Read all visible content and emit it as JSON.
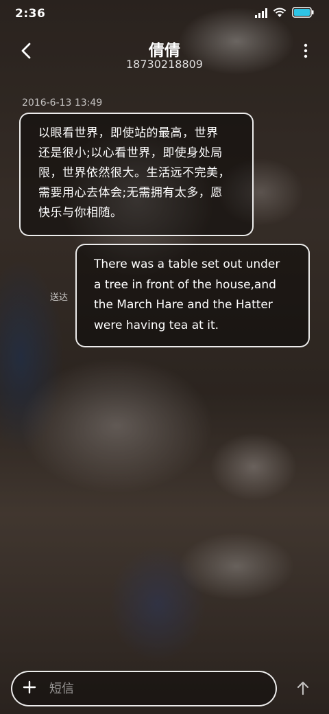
{
  "status_bar": {
    "time": "2:36",
    "icons": [
      "signal-icon",
      "wifi-icon",
      "battery-icon"
    ]
  },
  "header": {
    "contact_name": "倩倩",
    "contact_number": "18730218809",
    "back_icon": "back-arrow-icon",
    "more_icon": "more-vertical-icon"
  },
  "conversation": {
    "timestamp": "2016-6-13 13:49",
    "messages": [
      {
        "direction": "incoming",
        "lines": [
          "以眼看世界，即使站的最高，世界",
          "还是很小;以心看世界，即使身处局",
          "限，世界依然很大。生活远不完美，",
          "需要用心去体会;无需拥有太多，愿",
          "快乐与你相随。"
        ]
      },
      {
        "direction": "outgoing",
        "status": "送达",
        "lines": [
          "There was a table set out under",
          "a tree in front of the house,and",
          "the March Hare and the Hatter",
          "were having tea at it."
        ]
      }
    ]
  },
  "composer": {
    "placeholder": "短信",
    "add_icon": "plus-icon",
    "send_icon": "send-arrow-up-icon"
  },
  "colors": {
    "bubble_border": "#ffffff",
    "text": "#ffffff",
    "secondary_text": "#c8c8c8",
    "battery_fill": "#2ec4e6"
  }
}
